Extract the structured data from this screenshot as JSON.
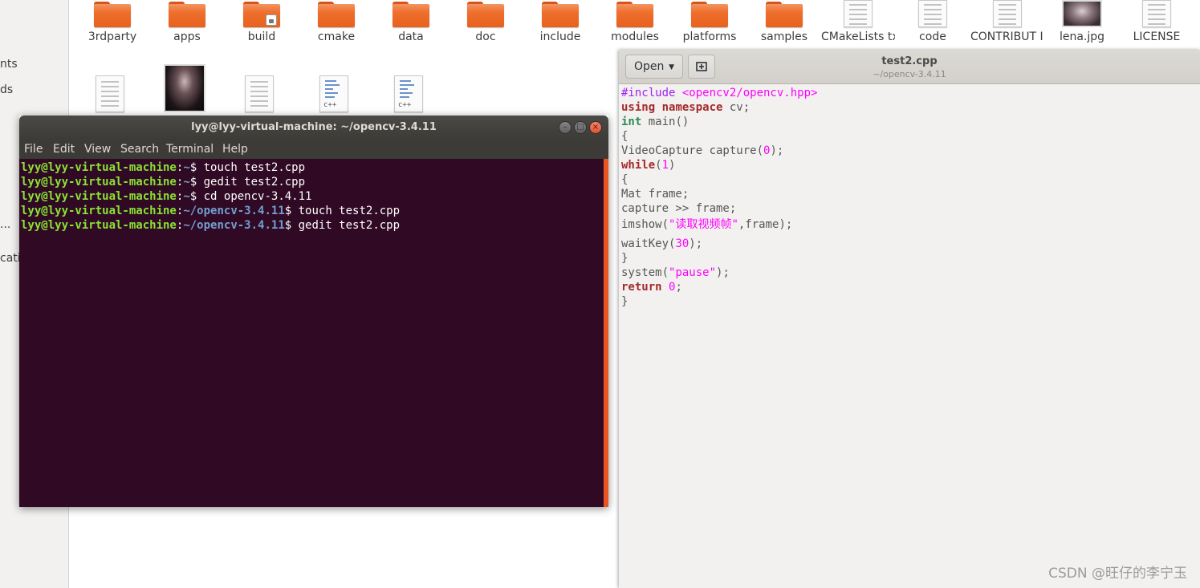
{
  "sidebar": {
    "fragments": [
      "nts",
      "ds",
      "...",
      "cati"
    ]
  },
  "files": {
    "row1": [
      {
        "label": "3rdparty",
        "kind": "folder"
      },
      {
        "label": "apps",
        "kind": "folder"
      },
      {
        "label": "build",
        "kind": "folder-locked"
      },
      {
        "label": "cmake",
        "kind": "folder"
      },
      {
        "label": "data",
        "kind": "folder"
      },
      {
        "label": "doc",
        "kind": "folder"
      },
      {
        "label": "include",
        "kind": "folder"
      },
      {
        "label": "modules",
        "kind": "folder"
      },
      {
        "label": "platforms",
        "kind": "folder"
      },
      {
        "label": "samples",
        "kind": "folder"
      },
      {
        "label": "CMakeLists txt",
        "kind": "text"
      },
      {
        "label": "code",
        "kind": "text"
      },
      {
        "label": "CONTRIBUT ING.md",
        "kind": "text"
      },
      {
        "label": "lena.jpg",
        "kind": "image"
      },
      {
        "label": "LICENSE",
        "kind": "text"
      }
    ],
    "row2": [
      {
        "kind": "text"
      },
      {
        "kind": "image"
      },
      {
        "kind": "text"
      },
      {
        "kind": "cpp",
        "glyph": "c++"
      },
      {
        "kind": "cpp",
        "glyph": "c++"
      }
    ]
  },
  "terminal": {
    "title": "lyy@lyy-virtual-machine: ~/opencv-3.4.11",
    "menu": [
      "File",
      "Edit",
      "View",
      "Search",
      "Terminal",
      "Help"
    ],
    "buttons": {
      "minimize": "–",
      "maximize": "□",
      "close": "×"
    },
    "lines": [
      {
        "user": "lyy@lyy-virtual-machine",
        "sep": ":",
        "path": "~",
        "prompt": "$ ",
        "cmd": "touch test2.cpp"
      },
      {
        "user": "lyy@lyy-virtual-machine",
        "sep": ":",
        "path": "~",
        "prompt": "$ ",
        "cmd": "gedit test2.cpp"
      },
      {
        "user": "lyy@lyy-virtual-machine",
        "sep": ":",
        "path": "~",
        "prompt": "$ ",
        "cmd": "cd opencv-3.4.11"
      },
      {
        "user": "lyy@lyy-virtual-machine",
        "sep": ":",
        "path": "~/opencv-3.4.11",
        "prompt": "$ ",
        "cmd": "touch test2.cpp"
      },
      {
        "user": "lyy@lyy-virtual-machine",
        "sep": ":",
        "path": "~/opencv-3.4.11",
        "prompt": "$ ",
        "cmd": "gedit test2.cpp"
      }
    ]
  },
  "gedit": {
    "open_label": "Open",
    "title": "test2.cpp",
    "subtitle": "~/opencv-3.4.11",
    "code": [
      [
        {
          "t": "#include ",
          "c": "pre"
        },
        {
          "t": "<opencv2/opencv.hpp>",
          "c": "str"
        }
      ],
      [
        {
          "t": "using",
          "c": "kw"
        },
        {
          "t": " ",
          "c": ""
        },
        {
          "t": "namespace",
          "c": "kw"
        },
        {
          "t": " cv;",
          "c": ""
        }
      ],
      [
        {
          "t": "int",
          "c": "type"
        },
        {
          "t": " main()",
          "c": ""
        }
      ],
      [
        {
          "t": "{",
          "c": ""
        }
      ],
      [
        {
          "t": "VideoCapture capture(",
          "c": ""
        },
        {
          "t": "0",
          "c": "num"
        },
        {
          "t": ");",
          "c": ""
        }
      ],
      [
        {
          "t": "while",
          "c": "kw"
        },
        {
          "t": "(",
          "c": ""
        },
        {
          "t": "1",
          "c": "num"
        },
        {
          "t": ")",
          "c": ""
        }
      ],
      [
        {
          "t": "{",
          "c": ""
        }
      ],
      [
        {
          "t": "Mat frame;",
          "c": ""
        }
      ],
      [
        {
          "t": "capture >> frame;",
          "c": ""
        }
      ],
      [
        {
          "t": "imshow(",
          "c": ""
        },
        {
          "t": "\"读取视频帧\"",
          "c": "str"
        },
        {
          "t": ",frame);",
          "c": ""
        }
      ],
      [
        {
          "t": "waitKey(",
          "c": ""
        },
        {
          "t": "30",
          "c": "num"
        },
        {
          "t": ");",
          "c": ""
        }
      ],
      [
        {
          "t": "}",
          "c": ""
        }
      ],
      [
        {
          "t": "system(",
          "c": ""
        },
        {
          "t": "\"pause\"",
          "c": "str"
        },
        {
          "t": ");",
          "c": ""
        }
      ],
      [
        {
          "t": "return",
          "c": "kw"
        },
        {
          "t": " ",
          "c": ""
        },
        {
          "t": "0",
          "c": "num"
        },
        {
          "t": ";",
          "c": ""
        }
      ],
      [
        {
          "t": "}",
          "c": ""
        }
      ]
    ]
  },
  "watermark": "CSDN @旺仔的李宁玉",
  "colors": {
    "terminal_bg": "#300a24",
    "prompt_user": "#8ae234",
    "prompt_path": "#729fcf",
    "accent": "#e95420",
    "folder": "#ef6f2d"
  }
}
